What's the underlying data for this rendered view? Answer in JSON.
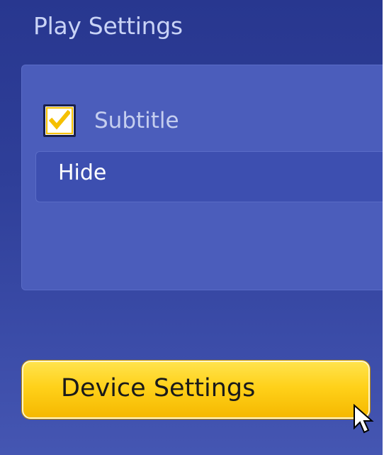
{
  "title": "Play Settings",
  "subtitle_option": {
    "label": "Subtitle",
    "checked": true
  },
  "subtitle_select": {
    "value": "Hide"
  },
  "device_settings_button": {
    "label": "Device Settings"
  },
  "colors": {
    "background": "#2f3f99",
    "panel": "#4b5dbb",
    "accent": "#ffd11a",
    "check": "#f5c000"
  },
  "icons": {
    "checkbox": "checkmark-icon",
    "cursor": "arrow-cursor-icon"
  }
}
